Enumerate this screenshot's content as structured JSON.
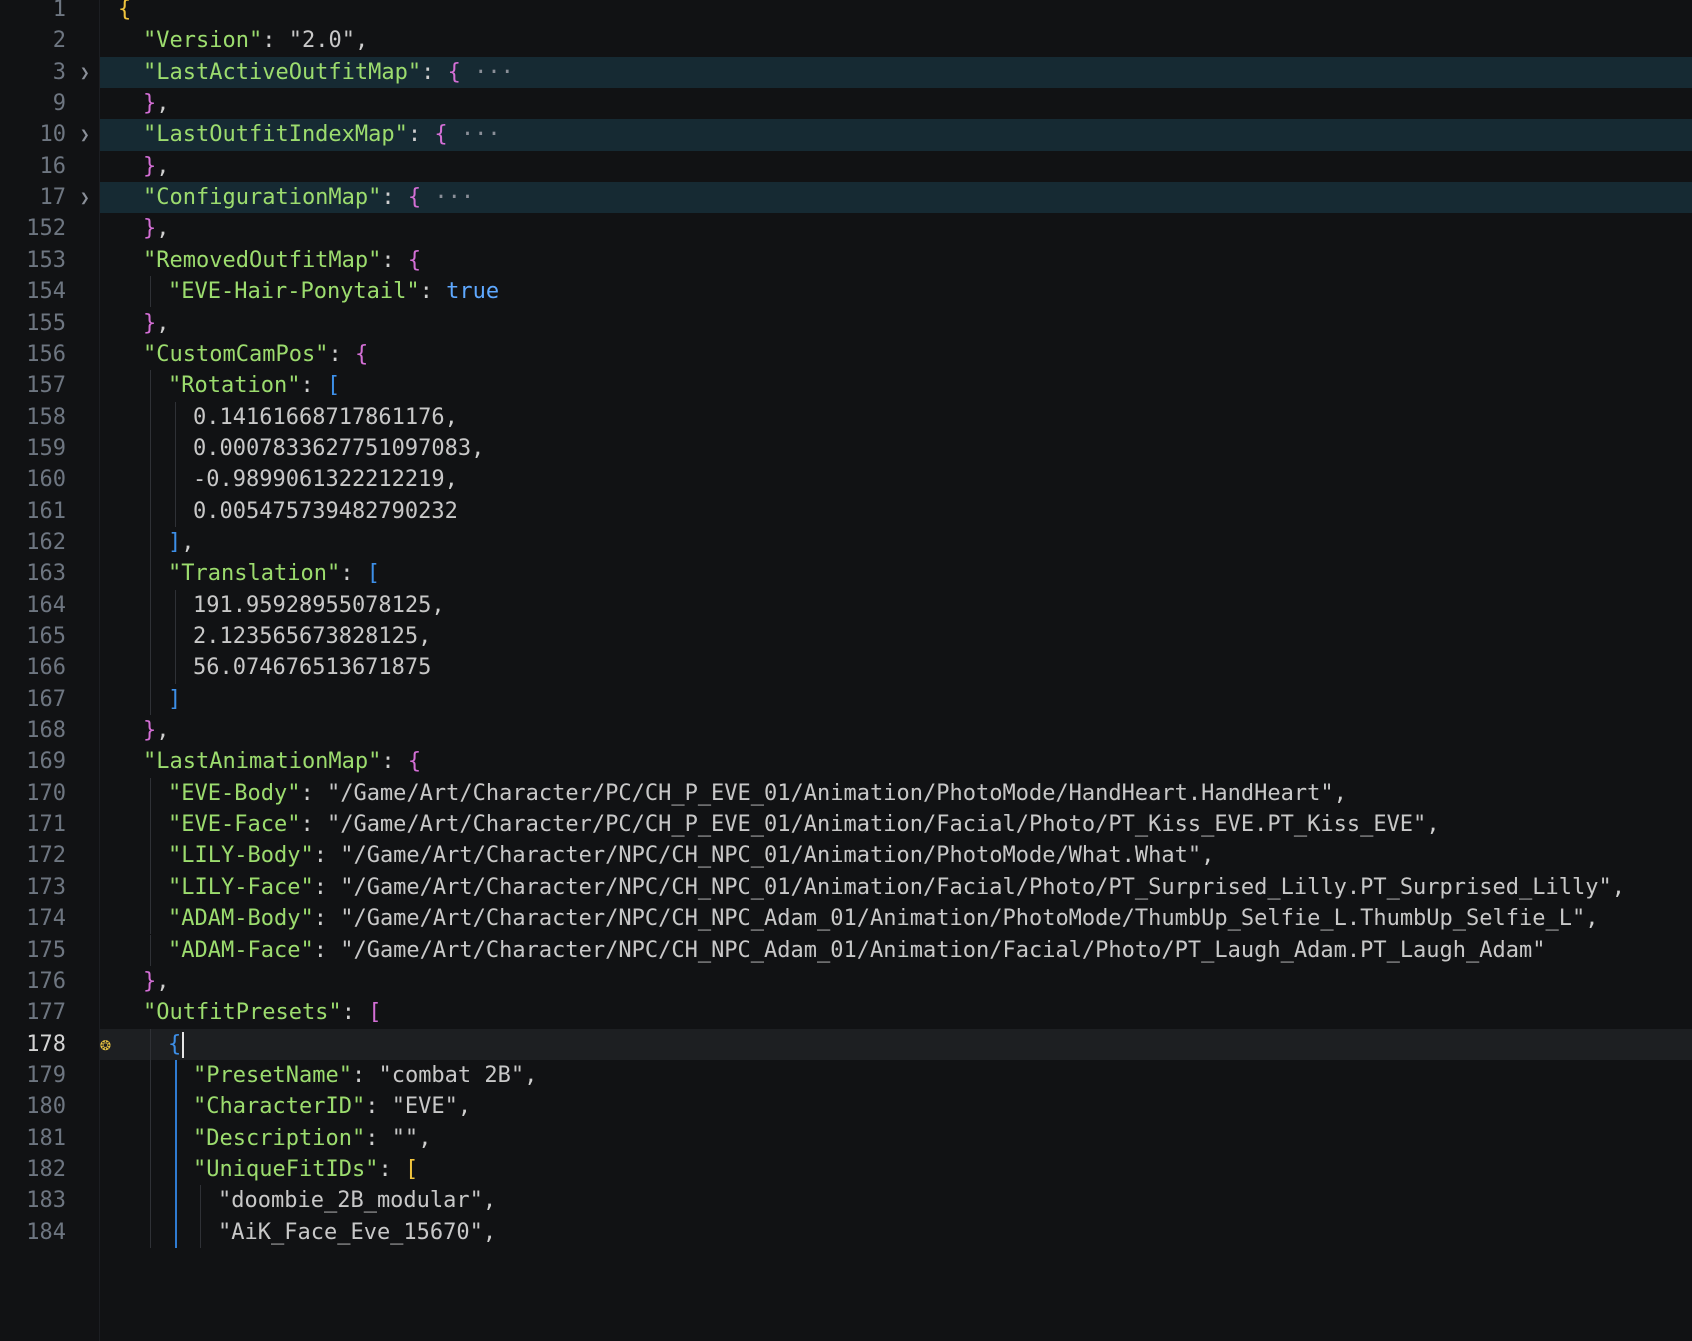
{
  "editor": {
    "lines": [
      {
        "n": "1",
        "indent": 0,
        "tokens": [
          {
            "t": "{",
            "c": "b1"
          }
        ]
      },
      {
        "n": "2",
        "indent": 1,
        "tokens": [
          {
            "t": "\"Version\"",
            "c": "k"
          },
          {
            "t": ": ",
            "c": "p"
          },
          {
            "t": "\"2.0\"",
            "c": "s"
          },
          {
            "t": ",",
            "c": "p"
          }
        ]
      },
      {
        "n": "3",
        "indent": 1,
        "folded": true,
        "tokens": [
          {
            "t": "\"LastActiveOutfitMap\"",
            "c": "k"
          },
          {
            "t": ": ",
            "c": "p"
          },
          {
            "t": "{",
            "c": "b2"
          },
          {
            "t": " ···",
            "c": "ell"
          }
        ]
      },
      {
        "n": "9",
        "indent": 1,
        "tokens": [
          {
            "t": "}",
            "c": "b2"
          },
          {
            "t": ",",
            "c": "p"
          }
        ]
      },
      {
        "n": "10",
        "indent": 1,
        "folded": true,
        "tokens": [
          {
            "t": "\"LastOutfitIndexMap\"",
            "c": "k"
          },
          {
            "t": ": ",
            "c": "p"
          },
          {
            "t": "{",
            "c": "b2"
          },
          {
            "t": " ···",
            "c": "ell"
          }
        ]
      },
      {
        "n": "16",
        "indent": 1,
        "tokens": [
          {
            "t": "}",
            "c": "b2"
          },
          {
            "t": ",",
            "c": "p"
          }
        ]
      },
      {
        "n": "17",
        "indent": 1,
        "folded": true,
        "tokens": [
          {
            "t": "\"ConfigurationMap\"",
            "c": "k"
          },
          {
            "t": ": ",
            "c": "p"
          },
          {
            "t": "{",
            "c": "b2"
          },
          {
            "t": " ···",
            "c": "ell"
          }
        ]
      },
      {
        "n": "152",
        "indent": 1,
        "tokens": [
          {
            "t": "}",
            "c": "b2"
          },
          {
            "t": ",",
            "c": "p"
          }
        ]
      },
      {
        "n": "153",
        "indent": 1,
        "tokens": [
          {
            "t": "\"RemovedOutfitMap\"",
            "c": "k"
          },
          {
            "t": ": ",
            "c": "p"
          },
          {
            "t": "{",
            "c": "b2"
          }
        ]
      },
      {
        "n": "154",
        "indent": 2,
        "tokens": [
          {
            "t": "\"EVE-Hair-Ponytail\"",
            "c": "k"
          },
          {
            "t": ": ",
            "c": "p"
          },
          {
            "t": "true",
            "c": "kw"
          }
        ]
      },
      {
        "n": "155",
        "indent": 1,
        "tokens": [
          {
            "t": "}",
            "c": "b2"
          },
          {
            "t": ",",
            "c": "p"
          }
        ]
      },
      {
        "n": "156",
        "indent": 1,
        "tokens": [
          {
            "t": "\"CustomCamPos\"",
            "c": "k"
          },
          {
            "t": ": ",
            "c": "p"
          },
          {
            "t": "{",
            "c": "b2"
          }
        ]
      },
      {
        "n": "157",
        "indent": 2,
        "tokens": [
          {
            "t": "\"Rotation\"",
            "c": "k"
          },
          {
            "t": ": ",
            "c": "p"
          },
          {
            "t": "[",
            "c": "b3"
          }
        ]
      },
      {
        "n": "158",
        "indent": 3,
        "tokens": [
          {
            "t": "0.14161668717861176",
            "c": "n"
          },
          {
            "t": ",",
            "c": "p"
          }
        ]
      },
      {
        "n": "159",
        "indent": 3,
        "tokens": [
          {
            "t": "0.0007833627751097083",
            "c": "n"
          },
          {
            "t": ",",
            "c": "p"
          }
        ]
      },
      {
        "n": "160",
        "indent": 3,
        "tokens": [
          {
            "t": "-0.9899061322212219",
            "c": "n"
          },
          {
            "t": ",",
            "c": "p"
          }
        ]
      },
      {
        "n": "161",
        "indent": 3,
        "tokens": [
          {
            "t": "0.005475739482790232",
            "c": "n"
          }
        ]
      },
      {
        "n": "162",
        "indent": 2,
        "tokens": [
          {
            "t": "]",
            "c": "b3"
          },
          {
            "t": ",",
            "c": "p"
          }
        ]
      },
      {
        "n": "163",
        "indent": 2,
        "tokens": [
          {
            "t": "\"Translation\"",
            "c": "k"
          },
          {
            "t": ": ",
            "c": "p"
          },
          {
            "t": "[",
            "c": "b3"
          }
        ]
      },
      {
        "n": "164",
        "indent": 3,
        "tokens": [
          {
            "t": "191.95928955078125",
            "c": "n"
          },
          {
            "t": ",",
            "c": "p"
          }
        ]
      },
      {
        "n": "165",
        "indent": 3,
        "tokens": [
          {
            "t": "2.123565673828125",
            "c": "n"
          },
          {
            "t": ",",
            "c": "p"
          }
        ]
      },
      {
        "n": "166",
        "indent": 3,
        "tokens": [
          {
            "t": "56.074676513671875",
            "c": "n"
          }
        ]
      },
      {
        "n": "167",
        "indent": 2,
        "tokens": [
          {
            "t": "]",
            "c": "b3"
          }
        ]
      },
      {
        "n": "168",
        "indent": 1,
        "tokens": [
          {
            "t": "}",
            "c": "b2"
          },
          {
            "t": ",",
            "c": "p"
          }
        ]
      },
      {
        "n": "169",
        "indent": 1,
        "tokens": [
          {
            "t": "\"LastAnimationMap\"",
            "c": "k"
          },
          {
            "t": ": ",
            "c": "p"
          },
          {
            "t": "{",
            "c": "b2"
          }
        ]
      },
      {
        "n": "170",
        "indent": 2,
        "tokens": [
          {
            "t": "\"EVE-Body\"",
            "c": "k"
          },
          {
            "t": ": ",
            "c": "p"
          },
          {
            "t": "\"/Game/Art/Character/PC/CH_P_EVE_01/Animation/PhotoMode/HandHeart.HandHeart\"",
            "c": "s"
          },
          {
            "t": ",",
            "c": "p"
          }
        ]
      },
      {
        "n": "171",
        "indent": 2,
        "tokens": [
          {
            "t": "\"EVE-Face\"",
            "c": "k"
          },
          {
            "t": ": ",
            "c": "p"
          },
          {
            "t": "\"/Game/Art/Character/PC/CH_P_EVE_01/Animation/Facial/Photo/PT_Kiss_EVE.PT_Kiss_EVE\"",
            "c": "s"
          },
          {
            "t": ",",
            "c": "p"
          }
        ]
      },
      {
        "n": "172",
        "indent": 2,
        "tokens": [
          {
            "t": "\"LILY-Body\"",
            "c": "k"
          },
          {
            "t": ": ",
            "c": "p"
          },
          {
            "t": "\"/Game/Art/Character/NPC/CH_NPC_01/Animation/PhotoMode/What.What\"",
            "c": "s"
          },
          {
            "t": ",",
            "c": "p"
          }
        ]
      },
      {
        "n": "173",
        "indent": 2,
        "tokens": [
          {
            "t": "\"LILY-Face\"",
            "c": "k"
          },
          {
            "t": ": ",
            "c": "p"
          },
          {
            "t": "\"/Game/Art/Character/NPC/CH_NPC_01/Animation/Facial/Photo/PT_Surprised_Lilly.PT_Surprised_Lilly\"",
            "c": "s"
          },
          {
            "t": ",",
            "c": "p"
          }
        ]
      },
      {
        "n": "174",
        "indent": 2,
        "tokens": [
          {
            "t": "\"ADAM-Body\"",
            "c": "k"
          },
          {
            "t": ": ",
            "c": "p"
          },
          {
            "t": "\"/Game/Art/Character/NPC/CH_NPC_Adam_01/Animation/PhotoMode/ThumbUp_Selfie_L.ThumbUp_Selfie_L\"",
            "c": "s"
          },
          {
            "t": ",",
            "c": "p"
          }
        ]
      },
      {
        "n": "175",
        "indent": 2,
        "tokens": [
          {
            "t": "\"ADAM-Face\"",
            "c": "k"
          },
          {
            "t": ": ",
            "c": "p"
          },
          {
            "t": "\"/Game/Art/Character/NPC/CH_NPC_Adam_01/Animation/Facial/Photo/PT_Laugh_Adam.PT_Laugh_Adam\"",
            "c": "s"
          }
        ]
      },
      {
        "n": "176",
        "indent": 1,
        "tokens": [
          {
            "t": "}",
            "c": "b2"
          },
          {
            "t": ",",
            "c": "p"
          }
        ]
      },
      {
        "n": "177",
        "indent": 1,
        "tokens": [
          {
            "t": "\"OutfitPresets\"",
            "c": "k"
          },
          {
            "t": ": ",
            "c": "p"
          },
          {
            "t": "[",
            "c": "b2"
          }
        ]
      },
      {
        "n": "178",
        "indent": 2,
        "active": true,
        "bulb": true,
        "cursor": true,
        "tokens": [
          {
            "t": "{",
            "c": "b3"
          }
        ]
      },
      {
        "n": "179",
        "indent": 3,
        "tokens": [
          {
            "t": "\"PresetName\"",
            "c": "k"
          },
          {
            "t": ": ",
            "c": "p"
          },
          {
            "t": "\"combat 2B\"",
            "c": "s"
          },
          {
            "t": ",",
            "c": "p"
          }
        ]
      },
      {
        "n": "180",
        "indent": 3,
        "tokens": [
          {
            "t": "\"CharacterID\"",
            "c": "k"
          },
          {
            "t": ": ",
            "c": "p"
          },
          {
            "t": "\"EVE\"",
            "c": "s"
          },
          {
            "t": ",",
            "c": "p"
          }
        ]
      },
      {
        "n": "181",
        "indent": 3,
        "tokens": [
          {
            "t": "\"Description\"",
            "c": "k"
          },
          {
            "t": ": ",
            "c": "p"
          },
          {
            "t": "\"\"",
            "c": "s"
          },
          {
            "t": ",",
            "c": "p"
          }
        ]
      },
      {
        "n": "182",
        "indent": 3,
        "tokens": [
          {
            "t": "\"UniqueFitIDs\"",
            "c": "k"
          },
          {
            "t": ": ",
            "c": "p"
          },
          {
            "t": "[",
            "c": "b1"
          }
        ]
      },
      {
        "n": "183",
        "indent": 4,
        "tokens": [
          {
            "t": "\"doombie_2B_modular\"",
            "c": "s"
          },
          {
            "t": ",",
            "c": "p"
          }
        ]
      },
      {
        "n": "184",
        "indent": 4,
        "tokens": [
          {
            "t": "\"AiK_Face_Eve_15670\"",
            "c": "s"
          },
          {
            "t": ",",
            "c": "p"
          }
        ]
      }
    ]
  },
  "icons": {
    "fold": "chevron-right-icon",
    "bulb": "lightbulb-icon"
  },
  "colors": {
    "background": "#111214",
    "key": "#9cdc6e",
    "string": "#c8c8c8",
    "keyword": "#5ea8ff",
    "bracket_gold": "#f0c43d",
    "bracket_magenta": "#d46fd6",
    "bracket_blue": "#3d8fe8",
    "line_number": "#6e7681"
  }
}
